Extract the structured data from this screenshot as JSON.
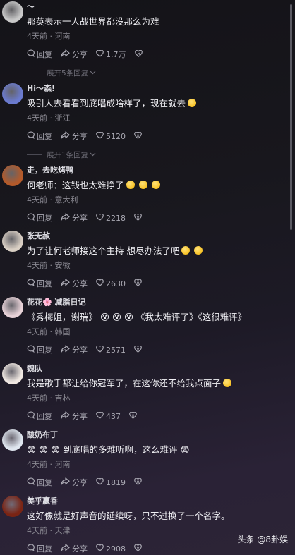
{
  "comments": [
    {
      "name": "～",
      "text": "那英表示一人战世界都没那么为难",
      "emojis": 0,
      "time": "4天前",
      "location": "河南",
      "reply": "回复",
      "share": "分享",
      "likes": "1.7万",
      "expand": "展开5条回复"
    },
    {
      "name": "Hi～森!",
      "text": "吸引人去看看到底唱成啥样了，现在就去",
      "emojis": 1,
      "time": "4天前",
      "location": "浙江",
      "reply": "回复",
      "share": "分享",
      "likes": "5120",
      "expand": "展开1条回复"
    },
    {
      "name": "走，去吃烤鸭",
      "text": "何老师：这钱也太难挣了",
      "emojis": 3,
      "time": "4天前",
      "location": "意大利",
      "reply": "回复",
      "share": "分享",
      "likes": "2218",
      "expand": ""
    },
    {
      "name": "张无赦",
      "text": "为了让何老师接这个主持 想尽办法了吧",
      "emojis": 2,
      "time": "4天前",
      "location": "安徽",
      "reply": "回复",
      "share": "分享",
      "likes": "2630",
      "expand": ""
    },
    {
      "name": "花花🌸 减脂日记",
      "text": "《秀梅姐，谢瑞》 😵 😵 😵 《我太难评了》《这很难评》",
      "emojis": 0,
      "time": "4天前",
      "location": "韩国",
      "reply": "回复",
      "share": "分享",
      "likes": "2571",
      "expand": ""
    },
    {
      "name": "魏队",
      "text": "我是歌手都让给你冠军了，在这你还不给我点面子",
      "emojis": 1,
      "time": "4天前",
      "location": "吉林",
      "reply": "回复",
      "share": "分享",
      "likes": "437",
      "expand": ""
    },
    {
      "name": "酸奶布丁",
      "text": "😨 😨 😨 到底唱的多难听啊，这么难评 😨",
      "emojis": 0,
      "time": "4天前",
      "location": "河南",
      "reply": "回复",
      "share": "分享",
      "likes": "1819",
      "expand": ""
    },
    {
      "name": "美乎赢香",
      "text": "这好像就是好声音的延续呀，只不过换了一个名字。",
      "emojis": 0,
      "time": "4天前",
      "location": "天津",
      "reply": "回复",
      "share": "分享",
      "likes": "2908",
      "expand": ""
    }
  ],
  "watermark": "头条 @8卦娱",
  "avatar_colors": [
    "#c9c9c9",
    "#6b7bd0",
    "#b45a2a",
    "#d9cfc4",
    "#e8d2d8",
    "#f0e8e2",
    "#dfe6ef",
    "#7a2414"
  ]
}
